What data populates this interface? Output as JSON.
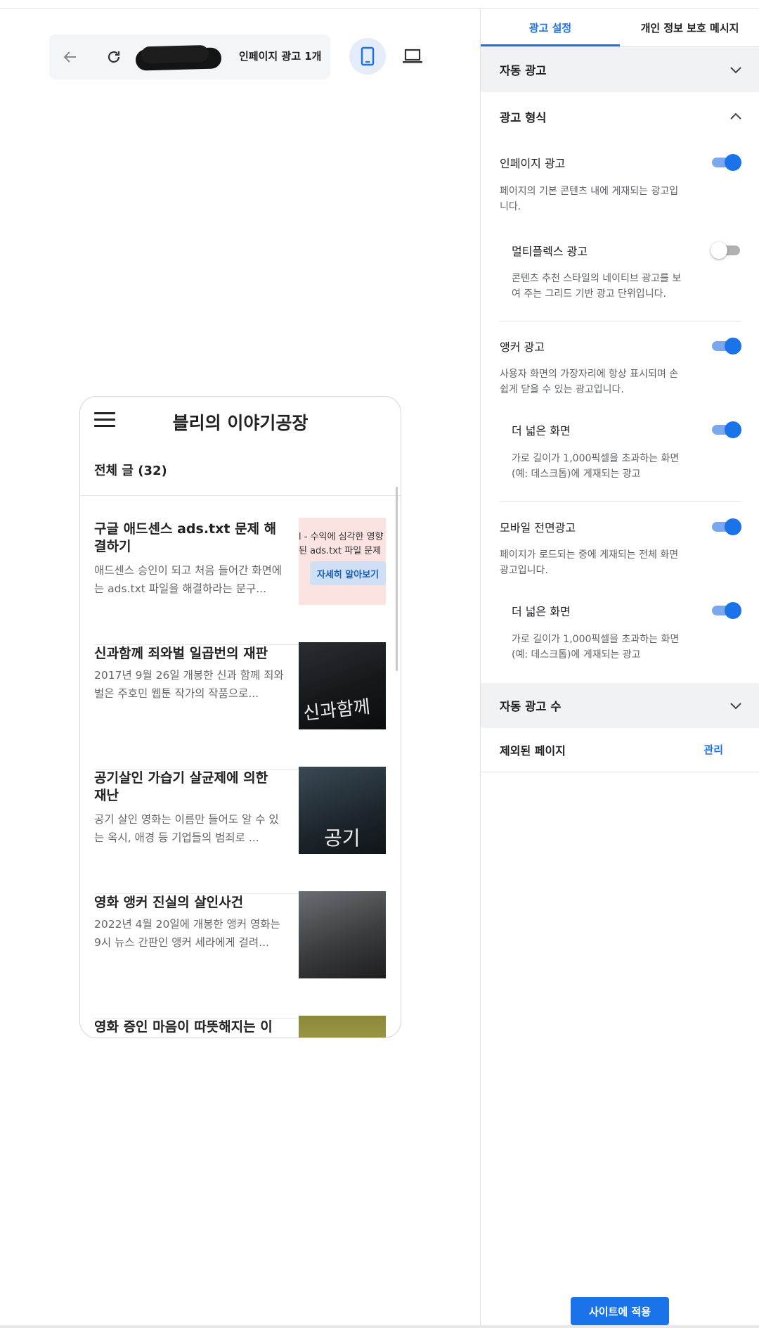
{
  "toolbar": {
    "back_icon": "arrow-left-icon",
    "reload_icon": "refresh-icon",
    "page_label": "인페이지 광고 1개",
    "mobile_icon": "smartphone-icon",
    "desktop_icon": "laptop-icon"
  },
  "preview": {
    "menu_icon": "hamburger-menu-icon",
    "blog_title": "블리의 이야기공장",
    "post_count_label": "전체 글 (32)",
    "posts": [
      {
        "title": "구글 애드센스 ads.txt 문제 해결하기",
        "excerpt": "애드센스 승인이 되고 처음 들어간 화면에는 ads.txt 파일을 해결하라는 문구...",
        "thumb": {
          "type": "ad",
          "line1": "l - 수익에 심각한 영향",
          "line2": "된 ads.txt 파일 문제",
          "button": "자세히 알아보기"
        }
      },
      {
        "title": "신과함께 죄와벌 일곱번의 재판",
        "excerpt": "2017년 9월 26일 개봉한 신과 함께 죄와 벌은 주호민 웹툰 작가의 작품으로...",
        "thumb": {
          "type": "poster",
          "text": "신과함께"
        }
      },
      {
        "title": "공기살인 가습기 살균제에 의한 재난",
        "excerpt": "공기 살인 영화는 이름만 들어도 알 수 있는 옥시, 애경 등 기업들의 범죄로 ...",
        "thumb": {
          "type": "poster",
          "text": "공기"
        }
      },
      {
        "title": "영화 앵커 진실의 살인사건",
        "excerpt": "2022년 4월 20일에 개봉한 앵커 영화는 9시 뉴스 간판인 앵커 세라에게 걸려...",
        "thumb": {
          "type": "poster",
          "text": ""
        }
      },
      {
        "title": "영화 증인 마음이 따뜻해지는 이",
        "excerpt": "",
        "thumb": {
          "type": "poster",
          "text": ""
        }
      }
    ]
  },
  "panel": {
    "tabs": [
      {
        "label": "광고 설정",
        "active": true
      },
      {
        "label": "개인 정보 보호 메시지",
        "active": false
      }
    ],
    "auto_ads": {
      "label": "자동 광고",
      "expanded": false
    },
    "ad_formats": {
      "label": "광고 형식",
      "expanded": true,
      "items": [
        {
          "title": "인페이지 광고",
          "desc_lines": [
            "페이지의 기본 콘텐츠 내에 게재되는 광고입",
            "니다."
          ],
          "on": true
        },
        {
          "title": "멀티플렉스 광고",
          "desc_lines": [
            "콘텐츠 추천 스타일의 네이티브 광고를 보",
            "여 주는 그리드 기반 광고 단위입니다."
          ],
          "on": false
        },
        {
          "title": "앵커 광고",
          "desc_lines": [
            "사용자 화면의 가장자리에 항상 표시되며 손",
            "쉽게 닫을 수 있는 광고입니다."
          ],
          "on": true
        },
        {
          "title": "더 넓은 화면",
          "desc_lines": [
            "가로 길이가 1,000픽셀을 초과하는 화면",
            "(예: 데스크톱)에 게재되는 광고"
          ],
          "on": true
        },
        {
          "title": "모바일 전면광고",
          "desc_lines": [
            "페이지가 로드되는 중에 게재되는 전체 화면",
            "광고입니다."
          ],
          "on": true
        },
        {
          "title": "더 넓은 화면",
          "desc_lines": [
            "가로 길이가 1,000픽셀을 초과하는 화면",
            "(예: 데스크톱)에 게재되는 광고"
          ],
          "on": true
        }
      ]
    },
    "ad_count": {
      "label": "자동 광고 수",
      "expanded": false
    },
    "excluded_pages": {
      "label": "제외된 페이지",
      "action": "관리"
    },
    "apply_button": "사이트에 적용"
  },
  "colors": {
    "accent": "#1a73e8",
    "section_bg": "#f1f2f4",
    "ad_bg": "#fbe3e2"
  }
}
